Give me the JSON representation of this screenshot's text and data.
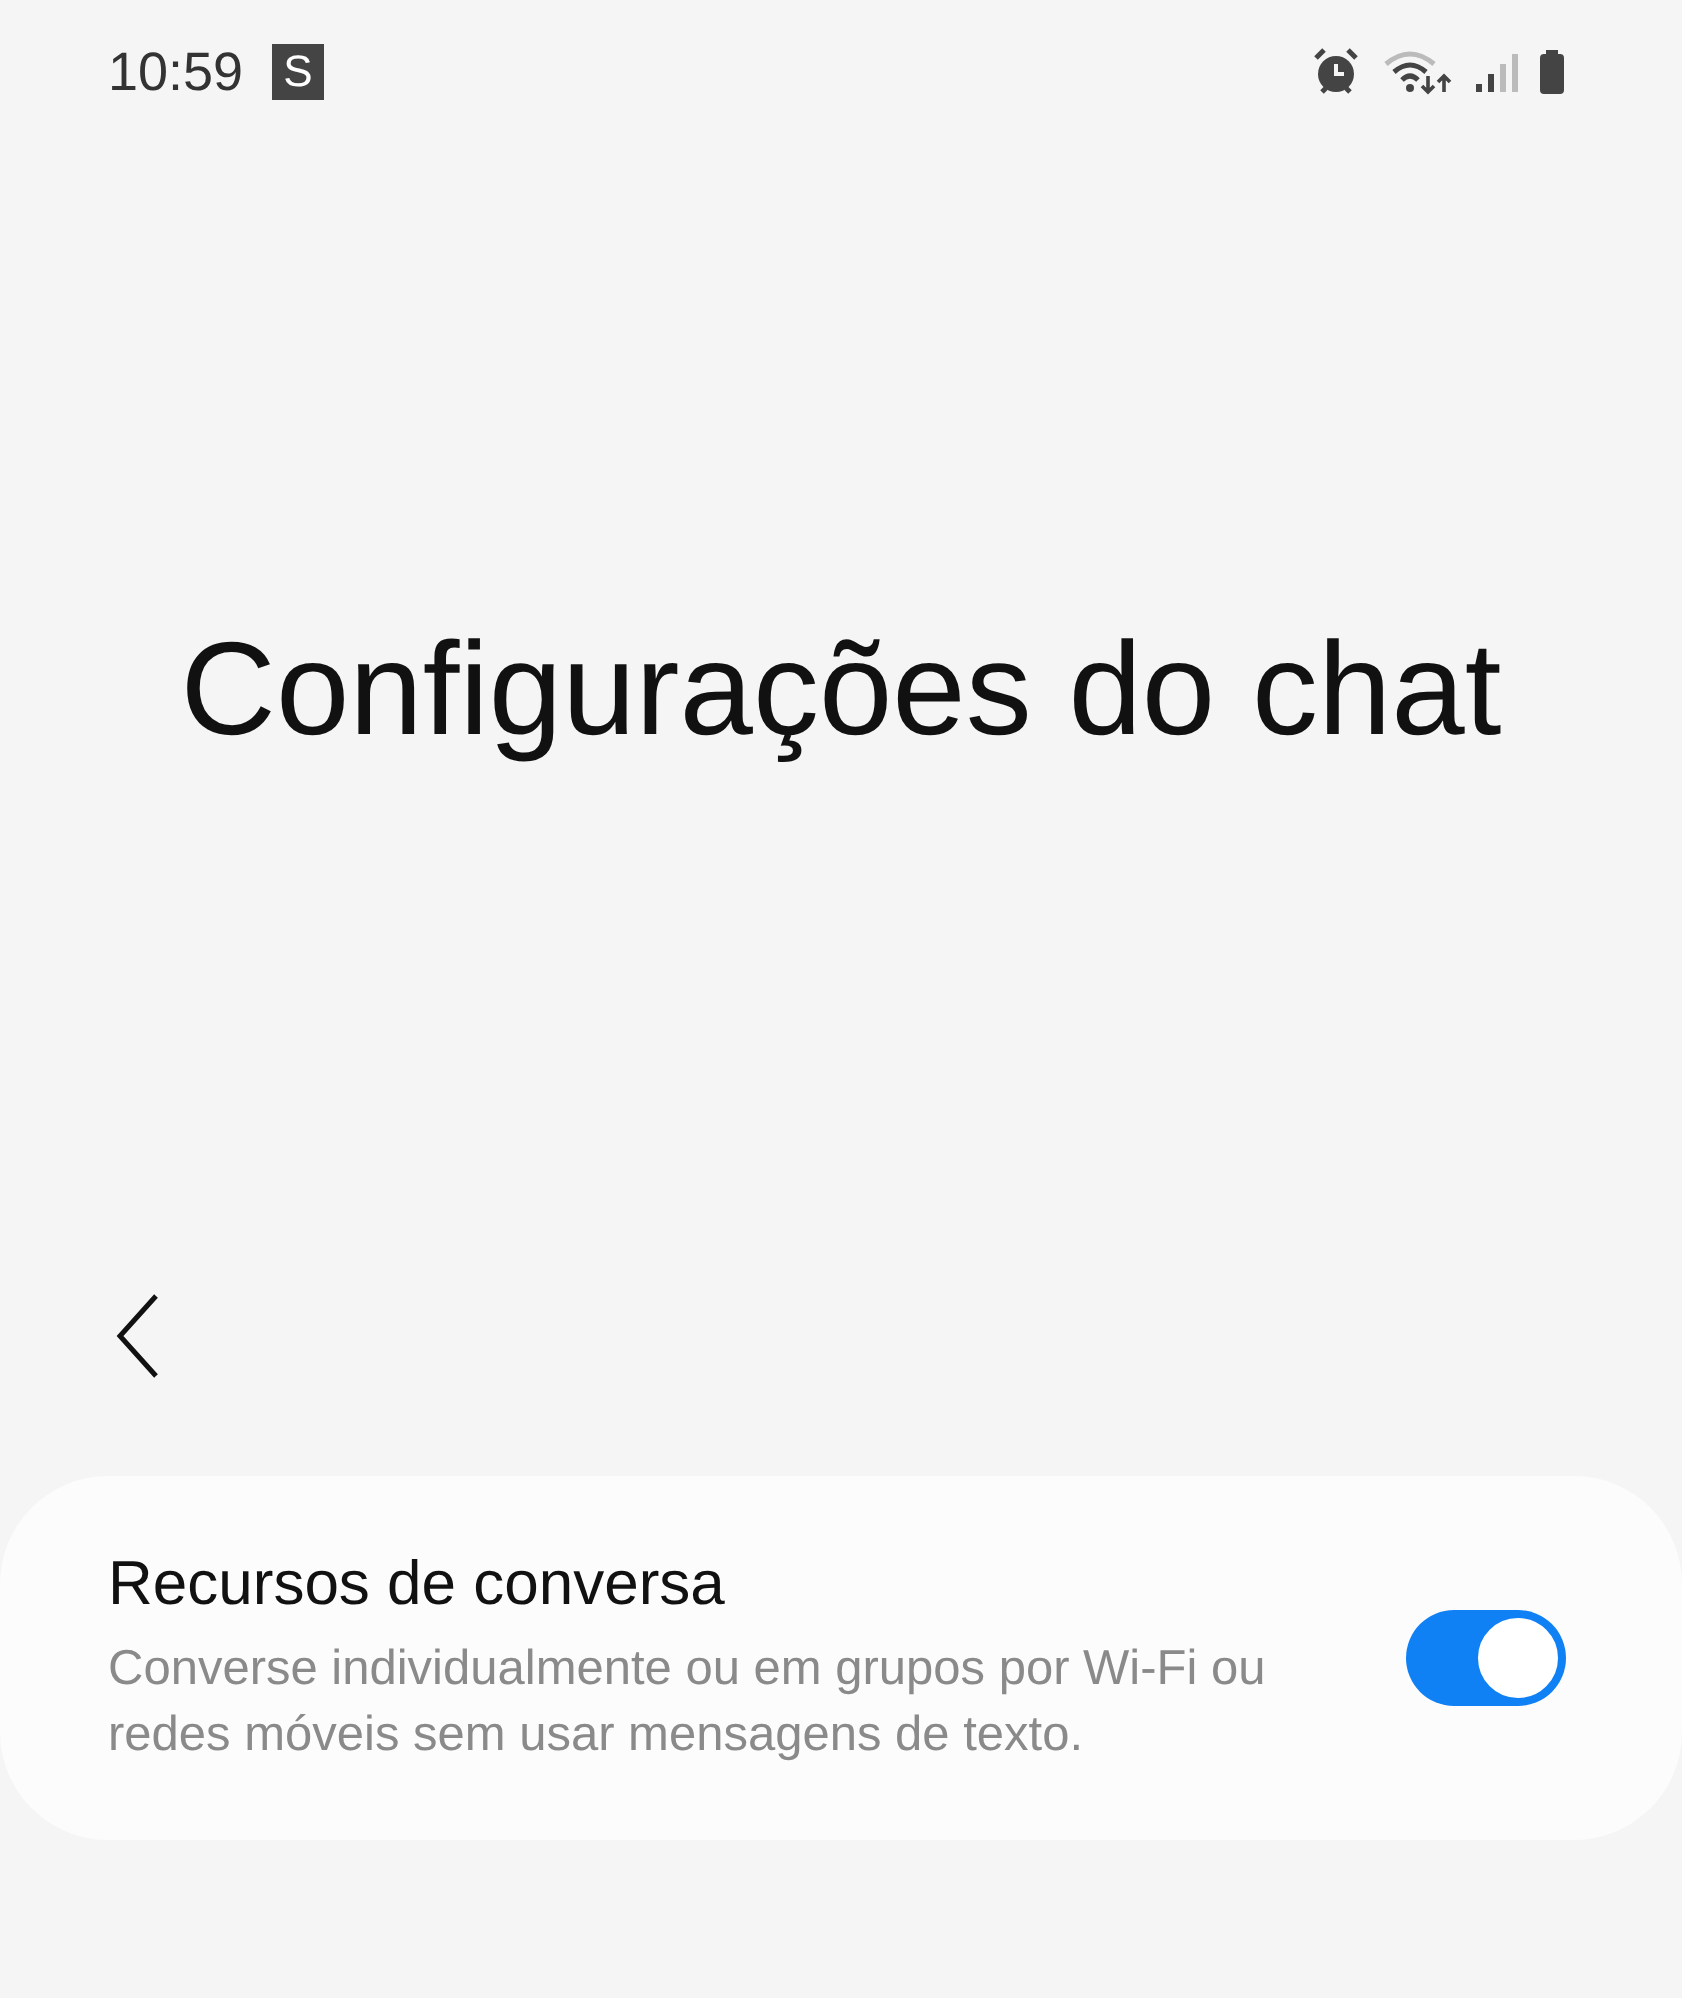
{
  "status_bar": {
    "time": "10:59",
    "app_badge": "S"
  },
  "title": "Configurações do chat",
  "setting": {
    "label": "Recursos de conversa",
    "description": "Converse individualmente ou em grupos por Wi-Fi ou redes móveis sem usar mensagens de texto.",
    "on": true
  }
}
